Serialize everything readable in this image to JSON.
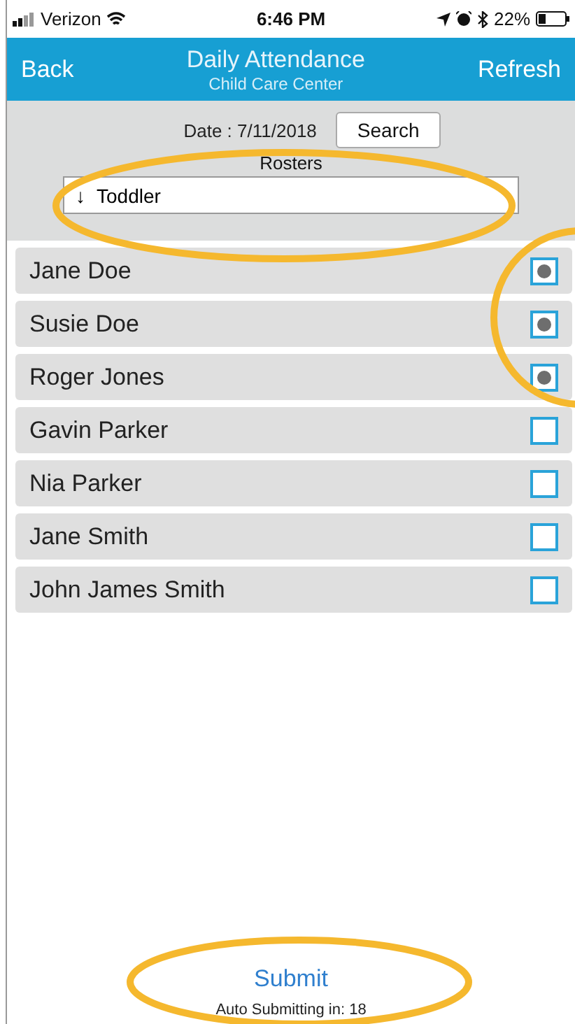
{
  "status_bar": {
    "carrier": "Verizon",
    "time": "6:46 PM",
    "battery": "22%"
  },
  "nav": {
    "back": "Back",
    "title": "Daily Attendance",
    "subtitle": "Child Care Center",
    "refresh": "Refresh"
  },
  "filter": {
    "date": "Date : 7/11/2018",
    "search": "Search",
    "rosters_label": "Rosters",
    "roster_arrow": "↓",
    "roster": "Toddler"
  },
  "children": [
    {
      "name": "Jane Doe",
      "checked": true
    },
    {
      "name": "Susie Doe",
      "checked": true
    },
    {
      "name": "Roger Jones",
      "checked": true
    },
    {
      "name": "Gavin Parker",
      "checked": false
    },
    {
      "name": "Nia Parker",
      "checked": false
    },
    {
      "name": "Jane Smith",
      "checked": false
    },
    {
      "name": "John James Smith",
      "checked": false
    }
  ],
  "submit": "Submit",
  "auto_submit": "Auto Submitting in: 18"
}
